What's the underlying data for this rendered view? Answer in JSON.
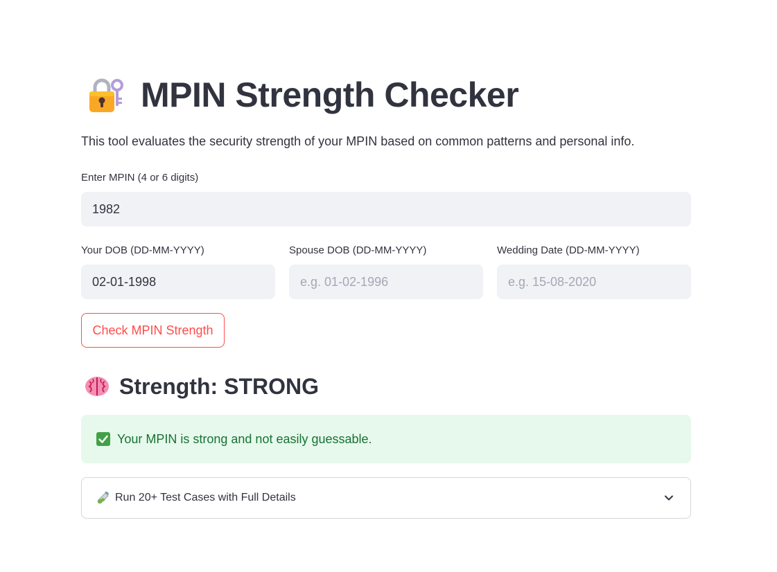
{
  "header": {
    "icon": "lock-with-key-icon",
    "title": "MPIN Strength Checker"
  },
  "description": "This tool evaluates the security strength of your MPIN based on common patterns and personal info.",
  "mpin": {
    "label": "Enter MPIN (4 or 6 digits)",
    "value": "1982"
  },
  "dob": {
    "label": "Your DOB (DD-MM-YYYY)",
    "value": "02-01-1998"
  },
  "spouse_dob": {
    "label": "Spouse DOB (DD-MM-YYYY)",
    "value": "",
    "placeholder": "e.g. 01-02-1996"
  },
  "wedding": {
    "label": "Wedding Date (DD-MM-YYYY)",
    "value": "",
    "placeholder": "e.g. 15-08-2020"
  },
  "check_button": "Check MPIN Strength",
  "result": {
    "icon": "brain-icon",
    "text": "Strength: STRONG"
  },
  "success": {
    "icon": "check-mark-icon",
    "text": "Your MPIN is strong and not easily guessable.",
    "colors": {
      "background": "#e7f9ec",
      "text": "#177233"
    }
  },
  "expander": {
    "icon": "test-tube-icon",
    "label": "Run 20+ Test Cases with Full Details",
    "chevron": "chevron-down-icon"
  },
  "colors": {
    "accent": "#ff4b4b",
    "text": "#31333f",
    "input_bg": "#f0f2f6"
  }
}
